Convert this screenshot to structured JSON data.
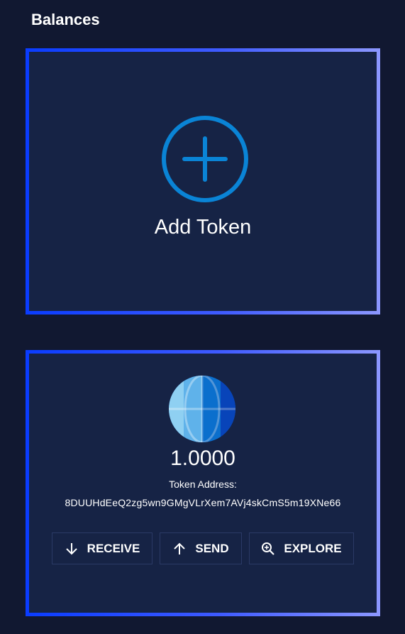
{
  "header": {
    "title": "Balances"
  },
  "add_token_card": {
    "label": "Add Token",
    "icon": "plus-circle-icon",
    "icon_color": "#0a84d6"
  },
  "token_card": {
    "icon": "globe-icon",
    "balance": "1.0000",
    "address_label": "Token Address:",
    "address": "8DUUHdEeQ2zg5wn9GMgVLrXem7AVj4skCmS5m19XNe66",
    "actions": [
      {
        "label": "RECEIVE",
        "icon": "arrow-down-icon"
      },
      {
        "label": "SEND",
        "icon": "arrow-up-icon"
      },
      {
        "label": "EXPLORE",
        "icon": "zoom-in-icon"
      }
    ]
  },
  "colors": {
    "background": "#111831",
    "card": "#162345",
    "border_gradient_start": "#0a3cff",
    "border_gradient_end": "#8c97ff"
  }
}
